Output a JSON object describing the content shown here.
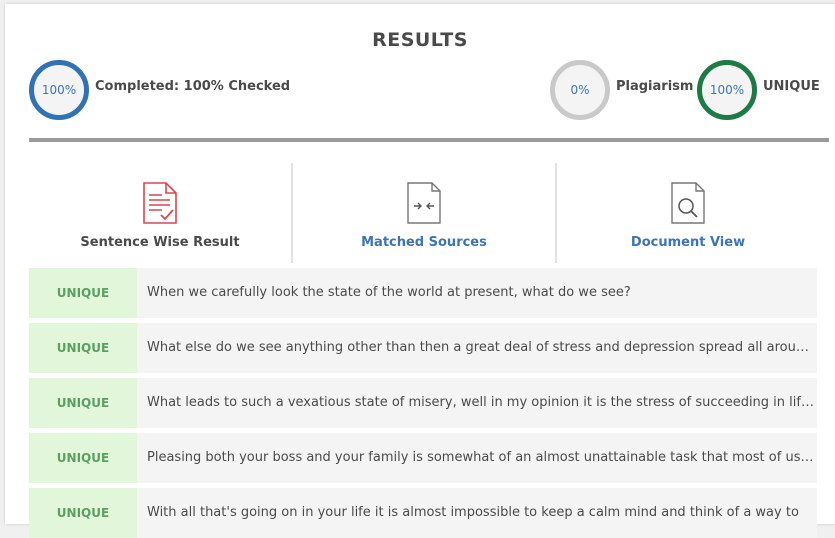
{
  "results": {
    "title": "RESULTS",
    "completed": {
      "ring_text": "100%",
      "label": "Completed: 100% Checked",
      "percent": 100
    },
    "plagiarism": {
      "ring_text": "0%",
      "label": "Plagiarism",
      "percent": 0
    },
    "unique": {
      "ring_text": "100%",
      "label": "UNIQUE",
      "percent": 100
    }
  },
  "tabs": [
    {
      "label": "Sentence Wise Result",
      "icon": "document-check-icon",
      "active": true
    },
    {
      "label": "Matched Sources",
      "icon": "compare-arrows-document-icon",
      "active": false
    },
    {
      "label": "Document View",
      "icon": "document-search-icon",
      "active": false
    }
  ],
  "rows": [
    {
      "status": "UNIQUE",
      "text": "When we carefully look the state of the world at present, what do we see?"
    },
    {
      "status": "UNIQUE",
      "text": "What else do we see anything other than then a great deal of stress and depression spread all around us?"
    },
    {
      "status": "UNIQUE",
      "text": "What leads to such a vexatious state of misery, well in my opinion it is the stress of succeeding in life that we all have."
    },
    {
      "status": "UNIQUE",
      "text": "Pleasing both your boss and your family is somewhat of an almost unattainable task that most of us try to accomplish."
    },
    {
      "status": "UNIQUE",
      "text": "With all that's going on in your life it is almost impossible to keep a calm mind and think of a way to"
    }
  ],
  "colors": {
    "ring_blue": "#2f73b5",
    "ring_grey": "#c9c9c9",
    "ring_green": "#1c7a45",
    "link_blue": "#3d74b8",
    "unique_bg": "#e2f7da",
    "unique_text": "#5aa060",
    "icon_red": "#d9474f"
  }
}
